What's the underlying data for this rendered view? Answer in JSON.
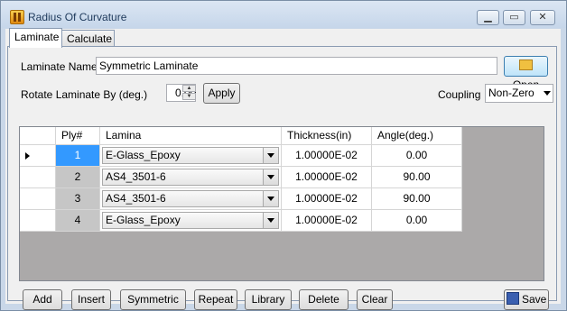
{
  "window": {
    "title": "Radius Of Curvature"
  },
  "tabs": [
    {
      "label": "Laminate"
    },
    {
      "label": "Calculate"
    }
  ],
  "form": {
    "name_label": "Laminate Name:",
    "name_value": "Symmetric Laminate",
    "open_label": "Open",
    "rotate_label": "Rotate Laminate By (deg.)",
    "rotate_value": "0.00",
    "apply_label": "Apply",
    "coupling_label": "Coupling",
    "coupling_value": "Non-Zero"
  },
  "grid": {
    "columns": [
      "Ply#",
      "Lamina",
      "Thickness(in)",
      "Angle(deg.)"
    ],
    "rows": [
      {
        "ply": "1",
        "lamina": "E-Glass_Epoxy",
        "thickness": "1.00000E-02",
        "angle": "0.00"
      },
      {
        "ply": "2",
        "lamina": "AS4_3501-6",
        "thickness": "1.00000E-02",
        "angle": "90.00"
      },
      {
        "ply": "3",
        "lamina": "AS4_3501-6",
        "thickness": "1.00000E-02",
        "angle": "90.00"
      },
      {
        "ply": "4",
        "lamina": "E-Glass_Epoxy",
        "thickness": "1.00000E-02",
        "angle": "0.00"
      }
    ]
  },
  "buttons": {
    "add": "Add",
    "insert": "Insert",
    "symmetric": "Symmetric",
    "repeat": "Repeat",
    "library": "Library",
    "delete": "Delete",
    "clear": "Clear",
    "save": "Save"
  }
}
